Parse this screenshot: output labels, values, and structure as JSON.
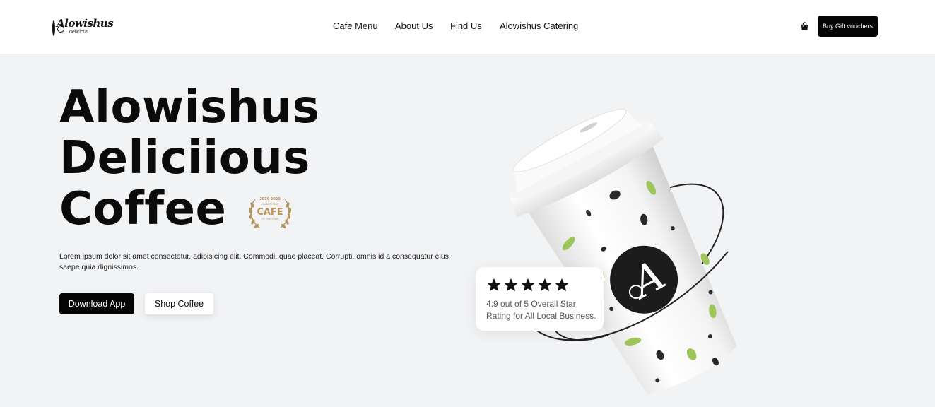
{
  "header": {
    "logo": {
      "name": "Alowishus",
      "sub": "delicious"
    },
    "nav": [
      {
        "label": "Cafe Menu"
      },
      {
        "label": "About Us"
      },
      {
        "label": "Find Us"
      },
      {
        "label": "Alowishus Catering"
      }
    ],
    "cart_icon": "shopping-bag-icon",
    "gift_button": "Buy Gift vouchers"
  },
  "hero": {
    "title_lines": [
      "Alowishus",
      "Deliciious",
      "Coffee"
    ],
    "award": {
      "years": "2019 2020",
      "text": "CAFE",
      "top_small": "COUNTRYWIDE",
      "bottom_small": "OF THE YEAR",
      "color": "#b8935a"
    },
    "description": "Lorem ipsum dolor sit amet consectetur, adipisicing elit. Commodi, quae placeat. Corrupti, omnis id a consequatur eius saepe quia dignissimos.",
    "buttons": {
      "download": "Download App",
      "shop": "Shop Coffee"
    }
  },
  "rating": {
    "stars": 5,
    "text": "4.9 out of 5 Overall Star Rating for All Local Business."
  },
  "colors": {
    "accent": "#050505",
    "background": "#f2f3f5",
    "leaf_green": "#9ec45c"
  }
}
